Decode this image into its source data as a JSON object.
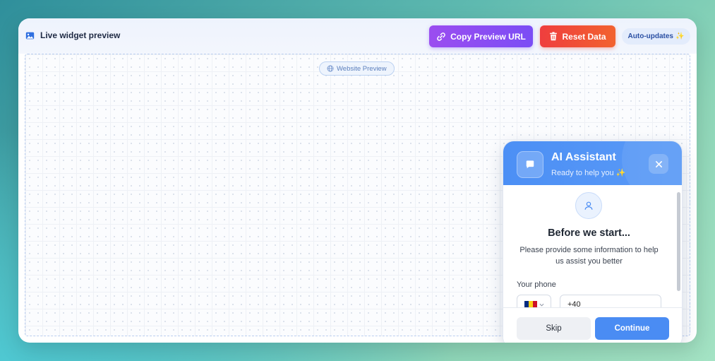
{
  "header": {
    "title": "Live widget preview",
    "title_icon": "image-icon",
    "copy_button": {
      "label": "Copy Preview URL",
      "icon": "link-icon",
      "color": "#8a4cf3"
    },
    "reset_button": {
      "label": "Reset Data",
      "icon": "trash-icon",
      "color": "#ef4b3a"
    },
    "auto_updates_badge": {
      "label": "Auto-updates",
      "emoji": "✨"
    }
  },
  "preview": {
    "pill_label": "Website Preview",
    "pill_icon": "globe-icon"
  },
  "widget": {
    "header": {
      "title": "AI Assistant",
      "subtitle": "Ready to help you",
      "subtitle_emoji": "✨",
      "avatar_icon": "chat-bubble-icon",
      "close_icon": "close-icon",
      "color": "#4c8ff5"
    },
    "body": {
      "user_icon": "user-icon",
      "title": "Before we start...",
      "description": "Please provide some information to help us assist you better",
      "phone_label": "Your phone",
      "country_flag": "flag-romania-icon",
      "phone_value": "+40"
    },
    "footer": {
      "skip_label": "Skip",
      "continue_label": "Continue",
      "continue_color": "#4a8cf3"
    }
  }
}
